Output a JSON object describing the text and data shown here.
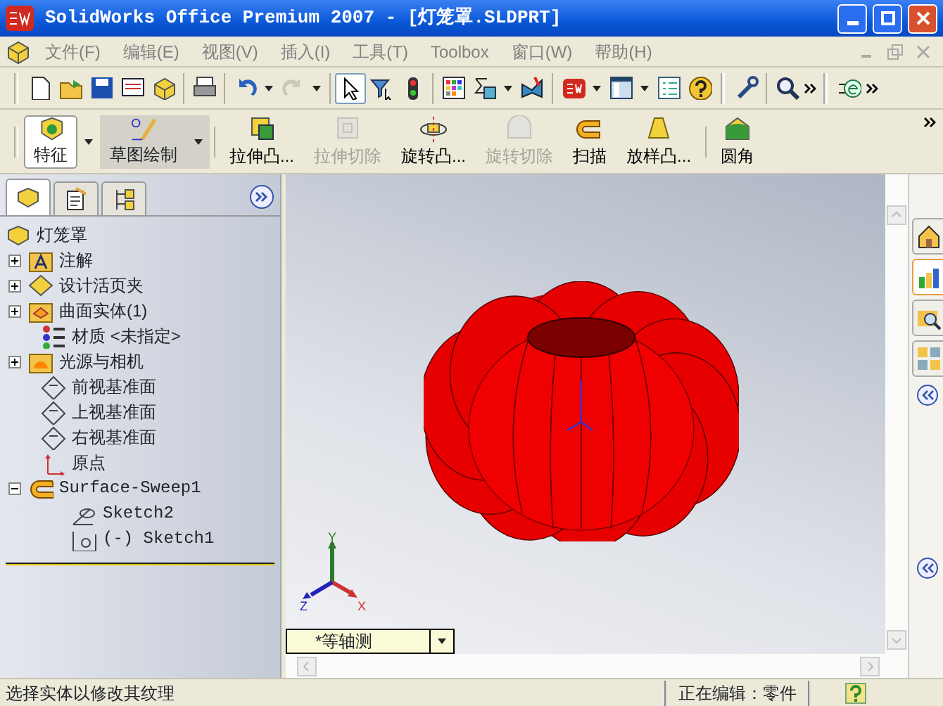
{
  "window": {
    "title": "SolidWorks Office Premium 2007 - [灯笼罩.SLDPRT]"
  },
  "menu": [
    "文件(F)",
    "编辑(E)",
    "视图(V)",
    "插入(I)",
    "工具(T)",
    "Toolbox",
    "窗口(W)",
    "帮助(H)"
  ],
  "standard_toolbar": {
    "undo": {
      "disabled": false
    },
    "redo": {
      "disabled": true
    },
    "select": {
      "selected": true
    }
  },
  "command_tabs": [
    {
      "label": "特征",
      "selected": true
    },
    {
      "label": "草图绘制",
      "selected": false
    }
  ],
  "commands": [
    {
      "label": "拉伸凸...",
      "disabled": false,
      "kind": "extrude"
    },
    {
      "label": "拉伸切除",
      "disabled": true,
      "kind": "cut"
    },
    {
      "label": "旋转凸...",
      "disabled": false,
      "kind": "revolve"
    },
    {
      "label": "旋转切除",
      "disabled": true,
      "kind": "revcut"
    },
    {
      "label": "扫描",
      "disabled": false,
      "kind": "sweep"
    },
    {
      "label": "放样凸...",
      "disabled": false,
      "kind": "loft"
    },
    {
      "label": "圆角",
      "disabled": false,
      "kind": "fillet"
    }
  ],
  "panel_tabs": [
    {
      "kind": "tree",
      "selected": true
    },
    {
      "kind": "property",
      "selected": false
    },
    {
      "kind": "config",
      "selected": false
    }
  ],
  "tree": {
    "root": "灯笼罩",
    "items": [
      {
        "label": "注解",
        "kind": "annotations",
        "expanded": false
      },
      {
        "label": "设计活页夹",
        "kind": "binder",
        "expanded": false
      },
      {
        "label": "曲面实体(1)",
        "kind": "bodies",
        "expanded": false
      },
      {
        "label": "材质 <未指定>",
        "kind": "material"
      },
      {
        "label": "光源与相机",
        "kind": "lights",
        "expanded": false
      },
      {
        "label": "前视基准面",
        "kind": "plane"
      },
      {
        "label": "上视基准面",
        "kind": "plane"
      },
      {
        "label": "右视基准面",
        "kind": "plane"
      },
      {
        "label": "原点",
        "kind": "origin"
      },
      {
        "label": "Surface-Sweep1",
        "kind": "sweep",
        "expanded": true,
        "children": [
          {
            "label": "Sketch2",
            "kind": "sketch"
          },
          {
            "label": "(-) Sketch1",
            "kind": "sketch1"
          }
        ]
      }
    ]
  },
  "viewport": {
    "triad": {
      "x": "X",
      "y": "Y",
      "z": "Z"
    },
    "view": "*等轴测"
  },
  "status_bar": {
    "message": "选择实体以修改其纹理",
    "mode": "正在编辑：零件"
  }
}
